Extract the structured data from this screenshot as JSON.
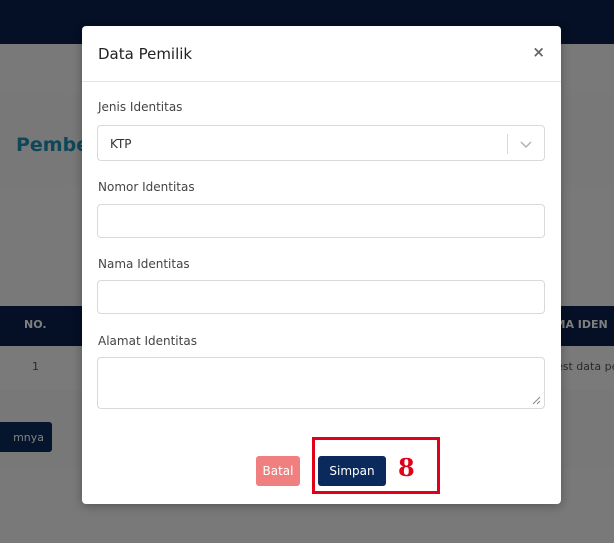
{
  "background": {
    "page_title_partial": "Pember",
    "table": {
      "headers": {
        "no": "NO.",
        "nama": "AMA IDEN"
      },
      "row": {
        "no": "1",
        "nama": "est data pe"
      }
    },
    "pager_label": "mnya"
  },
  "modal": {
    "title": "Data Pemilik",
    "close_symbol": "×",
    "fields": {
      "jenis": {
        "label": "Jenis Identitas",
        "value": "KTP"
      },
      "nomor": {
        "label": "Nomor Identitas",
        "value": "",
        "placeholder": ""
      },
      "nama": {
        "label": "Nama Identitas",
        "value": "",
        "placeholder": ""
      },
      "alamat": {
        "label": "Alamat Identitas",
        "value": ""
      }
    },
    "buttons": {
      "cancel": "Batal",
      "save": "Simpan"
    }
  },
  "annotation": {
    "number": "8",
    "color": "#e0001a"
  },
  "colors": {
    "navy": "#0b1f4a",
    "button_primary": "#0b2a5c",
    "button_cancel": "#f08080",
    "accent_title": "#1f8fb3"
  },
  "icons": {
    "select_arrow": "chevron-down-icon",
    "close": "close-icon",
    "resize": "resize-grip-icon"
  }
}
